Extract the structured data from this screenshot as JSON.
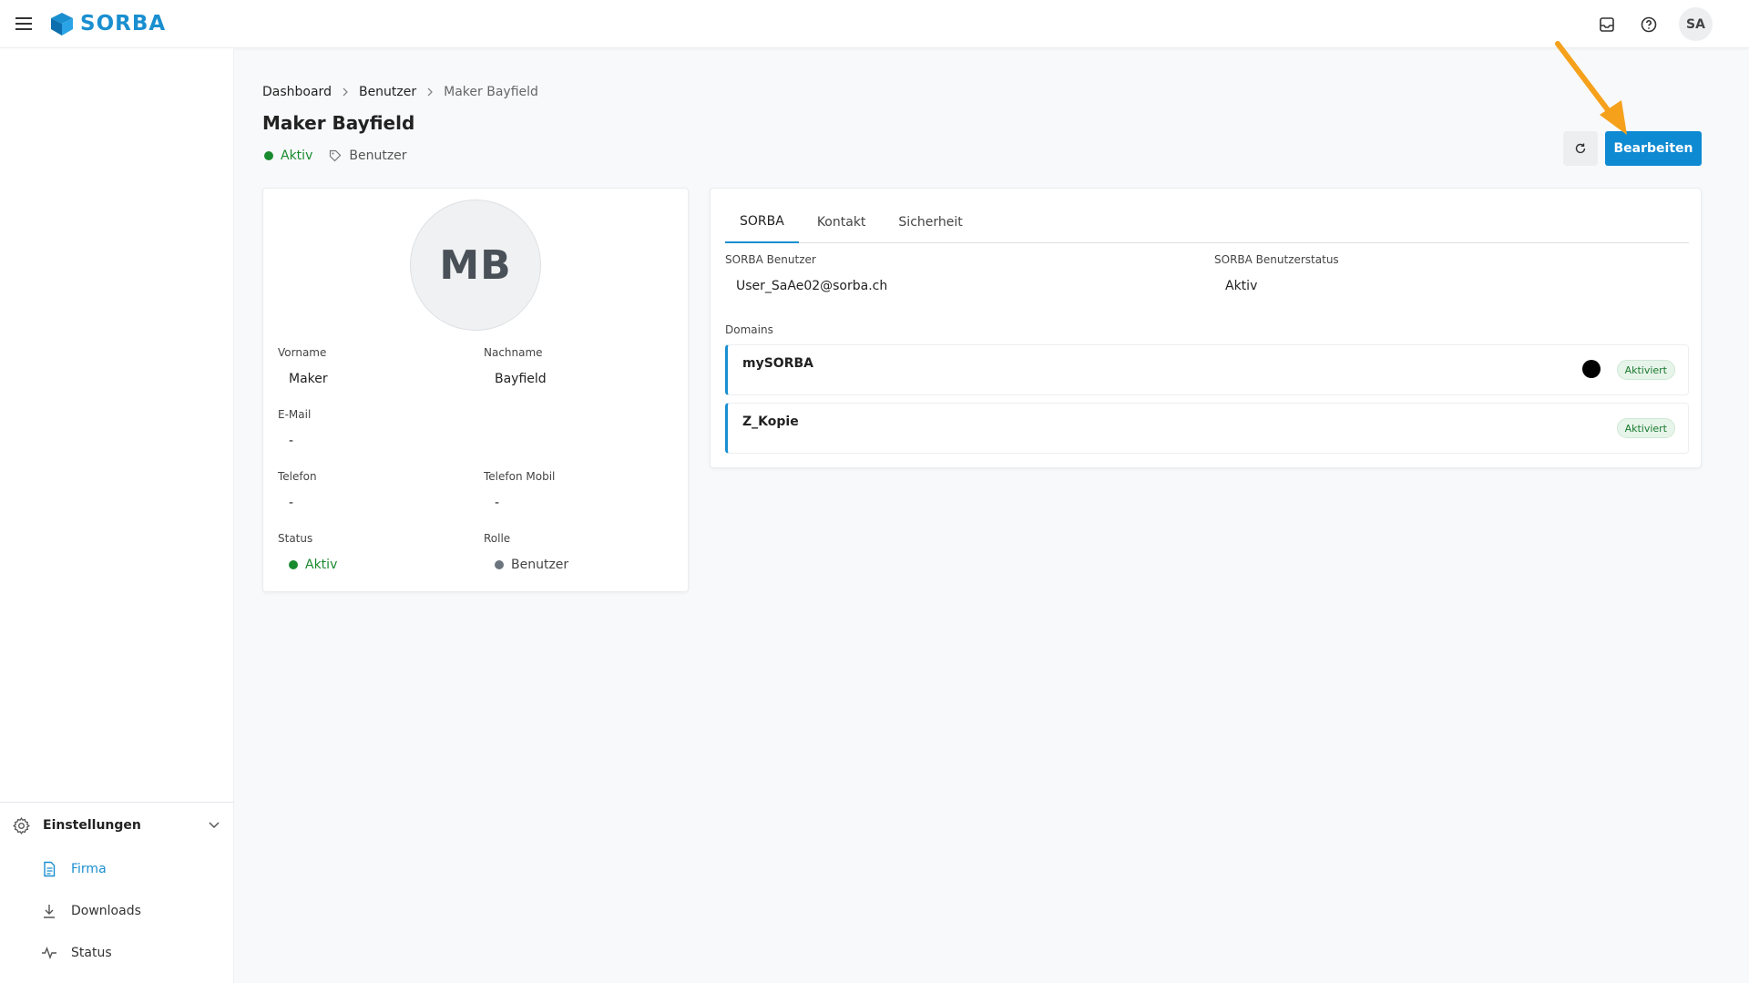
{
  "header": {
    "logo_text": "SORBA",
    "avatar_initials": "SA",
    "brand_color": "#1a8fd0"
  },
  "sidebar": {
    "section_label": "Einstellungen",
    "items": [
      {
        "label": "Firma",
        "icon": "document-icon",
        "active": true
      },
      {
        "label": "Downloads",
        "icon": "download-icon",
        "active": false
      },
      {
        "label": "Status",
        "icon": "activity-icon",
        "active": false
      }
    ]
  },
  "breadcrumb": [
    "Dashboard",
    "Benutzer",
    "Maker Bayfield"
  ],
  "page": {
    "title": "Maker Bayfield",
    "status": "Aktiv",
    "role": "Benutzer",
    "edit_label": "Bearbeiten"
  },
  "profile": {
    "initials": "MB",
    "fields": {
      "vorname_label": "Vorname",
      "vorname": "Maker",
      "nachname_label": "Nachname",
      "nachname": "Bayfield",
      "email_label": "E-Mail",
      "email": "-",
      "telefon_label": "Telefon",
      "telefon": "-",
      "telefon_mobil_label": "Telefon Mobil",
      "telefon_mobil": "-",
      "status_label": "Status",
      "status": "Aktiv",
      "rolle_label": "Rolle",
      "rolle": "Benutzer"
    }
  },
  "details": {
    "tabs": [
      "SORBA",
      "Kontakt",
      "Sicherheit"
    ],
    "active_tab": "SORBA",
    "sorba_user_label": "SORBA Benutzer",
    "sorba_user": "User_SaAe02@sorba.ch",
    "sorba_status_label": "SORBA Benutzerstatus",
    "sorba_status": "Aktiv",
    "domains_label": "Domains",
    "domains": [
      {
        "name": "mySORBA",
        "badge": "Aktiviert"
      },
      {
        "name": "Z_Kopie",
        "badge": "Aktiviert"
      }
    ]
  }
}
